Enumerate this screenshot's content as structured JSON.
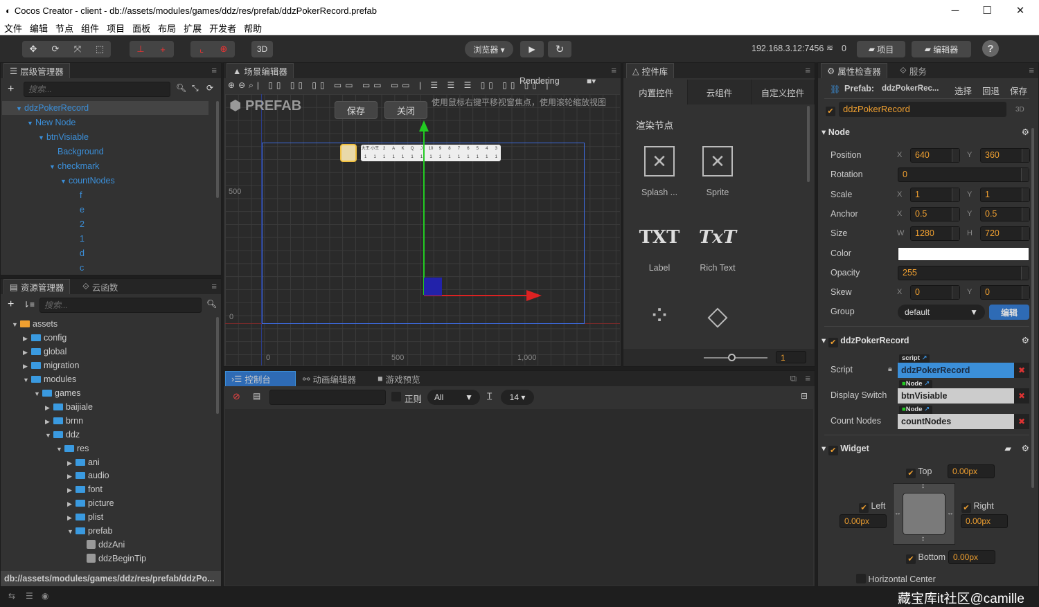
{
  "window": {
    "title": "Cocos Creator - client - db://assets/modules/games/ddz/res/prefab/ddzPokerRecord.prefab",
    "minimize": "─",
    "maximize": "☐",
    "close": "✕"
  },
  "menu": [
    "文件",
    "编辑",
    "节点",
    "组件",
    "项目",
    "面板",
    "布局",
    "扩展",
    "开发者",
    "帮助"
  ],
  "toolbar": {
    "btn_3d": "3D",
    "browser": "浏览器 ▾",
    "play": "▶",
    "refresh": "↻",
    "ip": "192.168.3.12:7456",
    "connections": "0",
    "project": "项目",
    "editor": "编辑器",
    "help": "?"
  },
  "hierarchy": {
    "tab": "层级管理器",
    "search_placeholder": "搜索...",
    "items": [
      {
        "label": "ddzPokerRecord",
        "depth": 0,
        "expanded": true,
        "selected": true
      },
      {
        "label": "New Node",
        "depth": 1,
        "expanded": true
      },
      {
        "label": "btnVisiable",
        "depth": 2,
        "expanded": true
      },
      {
        "label": "Background",
        "depth": 3
      },
      {
        "label": "checkmark",
        "depth": 3,
        "expanded": true
      },
      {
        "label": "countNodes",
        "depth": 4,
        "expanded": true
      },
      {
        "label": "f",
        "depth": 5
      },
      {
        "label": "e",
        "depth": 5
      },
      {
        "label": "2",
        "depth": 5
      },
      {
        "label": "1",
        "depth": 5
      },
      {
        "label": "d",
        "depth": 5
      },
      {
        "label": "c",
        "depth": 5
      }
    ]
  },
  "assets": {
    "tab": "资源管理器",
    "tab2": "云函数",
    "search_placeholder": "搜索...",
    "path": "db://assets/modules/games/ddz/res/prefab/ddzPo...",
    "items": [
      {
        "label": "assets",
        "depth": 0,
        "type": "root",
        "expanded": true
      },
      {
        "label": "config",
        "depth": 1,
        "type": "folder"
      },
      {
        "label": "global",
        "depth": 1,
        "type": "folder"
      },
      {
        "label": "migration",
        "depth": 1,
        "type": "folder"
      },
      {
        "label": "modules",
        "depth": 1,
        "type": "folder",
        "expanded": true
      },
      {
        "label": "games",
        "depth": 2,
        "type": "folder",
        "expanded": true
      },
      {
        "label": "baijiale",
        "depth": 3,
        "type": "folder"
      },
      {
        "label": "brnn",
        "depth": 3,
        "type": "folder"
      },
      {
        "label": "ddz",
        "depth": 3,
        "type": "folder",
        "expanded": true
      },
      {
        "label": "res",
        "depth": 4,
        "type": "folder",
        "expanded": true
      },
      {
        "label": "ani",
        "depth": 5,
        "type": "folder"
      },
      {
        "label": "audio",
        "depth": 5,
        "type": "folder"
      },
      {
        "label": "font",
        "depth": 5,
        "type": "folder"
      },
      {
        "label": "picture",
        "depth": 5,
        "type": "folder"
      },
      {
        "label": "plist",
        "depth": 5,
        "type": "folder"
      },
      {
        "label": "prefab",
        "depth": 5,
        "type": "folder",
        "expanded": true
      },
      {
        "label": "ddzAni",
        "depth": 6,
        "type": "prefab"
      },
      {
        "label": "ddzBeginTip",
        "depth": 6,
        "type": "prefab"
      }
    ]
  },
  "scene": {
    "tab": "场景编辑器",
    "rendering": "Rendering",
    "mode": "PREFAB",
    "save": "保存",
    "close": "关闭",
    "hint": "使用鼠标右键平移视窗焦点，使用滚轮缩放视图",
    "y_ticks": [
      "500",
      "0"
    ],
    "x_ticks": [
      "0",
      "500",
      "1,000"
    ],
    "card": {
      "labels": [
        "大王",
        "小王",
        "2",
        "A",
        "K",
        "Q",
        "J",
        "10",
        "9",
        "8",
        "7",
        "6",
        "5",
        "4",
        "3"
      ],
      "counts": [
        "1",
        "1",
        "1",
        "1",
        "1",
        "1",
        "1",
        "1",
        "1",
        "1",
        "1",
        "1",
        "1",
        "1",
        "1"
      ]
    }
  },
  "library": {
    "tab": "控件库",
    "tabs": [
      "内置控件",
      "云组件",
      "自定义控件"
    ],
    "section": "渲染节点",
    "items": [
      {
        "label": "Splash ...",
        "icon": "sprite-splash-icon"
      },
      {
        "label": "Sprite",
        "icon": "sprite-icon"
      },
      {
        "label": "Label",
        "glyph": "TXT"
      },
      {
        "label": "Rich Text",
        "glyph": "TxT"
      },
      {
        "label": "",
        "icon": "particle-icon"
      },
      {
        "label": "",
        "icon": "tiledmap-icon"
      }
    ],
    "zoom_value": "1"
  },
  "console": {
    "tabs": [
      "控制台",
      "动画编辑器",
      "游戏预览"
    ],
    "regex": "正则",
    "level": "All",
    "font_size": "14 ▾"
  },
  "inspector": {
    "tab": "属性检查器",
    "tab2": "服务",
    "prefab_label": "Prefab:",
    "prefab_name": "ddzPokerRec...",
    "select": "选择",
    "revert": "回退",
    "save": "保存",
    "node_name": "ddzPokerRecord",
    "badge_3d": "3D",
    "node_section": "Node",
    "props": [
      {
        "label": "Position",
        "a": "X",
        "av": "640",
        "b": "Y",
        "bv": "360"
      },
      {
        "label": "Rotation",
        "v": "0"
      },
      {
        "label": "Scale",
        "a": "X",
        "av": "1",
        "b": "Y",
        "bv": "1"
      },
      {
        "label": "Anchor",
        "a": "X",
        "av": "0.5",
        "b": "Y",
        "bv": "0.5"
      },
      {
        "label": "Size",
        "a": "W",
        "av": "1280",
        "b": "H",
        "bv": "720"
      },
      {
        "label": "Color",
        "color": "#ffffff"
      },
      {
        "label": "Opacity",
        "v": "255"
      },
      {
        "label": "Skew",
        "a": "X",
        "av": "0",
        "b": "Y",
        "bv": "0"
      },
      {
        "label": "Group",
        "select": "default",
        "edit": "编辑"
      }
    ],
    "component": "ddzPokerRecord",
    "fields": [
      {
        "label": "Script",
        "tag": "script",
        "value": "ddzPokerRecord"
      },
      {
        "label": "Display Switch",
        "tag": "Node",
        "value": "btnVisiable"
      },
      {
        "label": "Count Nodes",
        "tag": "Node",
        "value": "countNodes"
      }
    ],
    "widget": {
      "title": "Widget",
      "top": "Top",
      "left": "Left",
      "right": "Right",
      "bottom": "Bottom",
      "top_v": "0.00px",
      "left_v": "0.00px",
      "right_v": "0.00px",
      "bottom_v": "0.00px",
      "more": "Horizontal Center"
    }
  },
  "overlay_text": "藏宝库it社区@camille",
  "colors": {
    "accent": "#3b8fd9",
    "value": "#f0a030",
    "selected": "#2e6bb5"
  }
}
